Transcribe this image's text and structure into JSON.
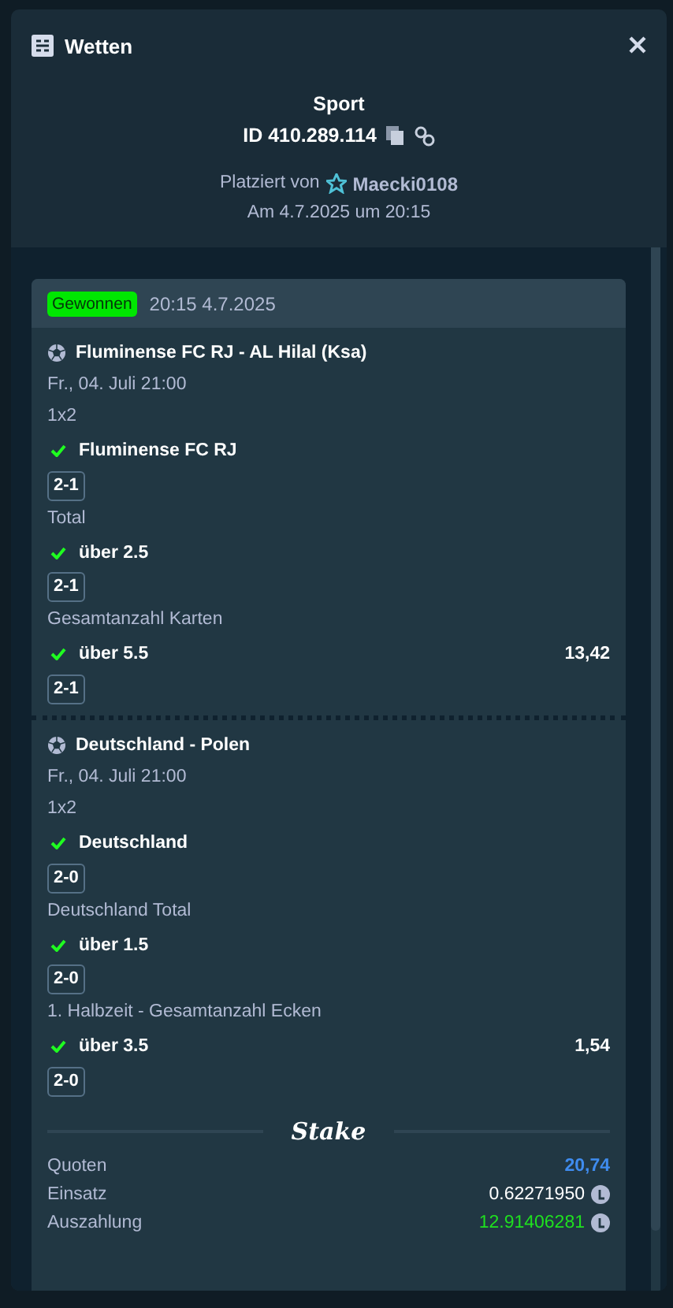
{
  "dialog": {
    "title": "Wetten"
  },
  "bet": {
    "category": "Sport",
    "id": "ID 410.289.114",
    "placed_by_label": "Platziert von",
    "user": "Maecki0108",
    "placed_at": "Am 4.7.2025 um 20:15"
  },
  "slip": {
    "status": {
      "label": "Gewonnen",
      "kind": "won"
    },
    "time": "20:15 4.7.2025",
    "events": [
      {
        "title": "Fluminense FC RJ - AL Hilal (Ksa)",
        "date": "Fr., 04. Juli 21:00",
        "markets": [
          {
            "market": "1x2",
            "selection": "Fluminense FC RJ",
            "won": true,
            "score": "2-1"
          },
          {
            "market": "Total",
            "selection": "über 2.5",
            "won": true,
            "score": "2-1"
          },
          {
            "market": "Gesamtanzahl Karten",
            "selection": "über 5.5",
            "won": true,
            "score": "2-1",
            "odds": "13,42"
          }
        ]
      },
      {
        "title": "Deutschland - Polen",
        "date": "Fr., 04. Juli 21:00",
        "markets": [
          {
            "market": "1x2",
            "selection": "Deutschland",
            "won": true,
            "score": "2-0"
          },
          {
            "market": "Deutschland Total",
            "selection": "über 1.5",
            "won": true,
            "score": "2-0"
          },
          {
            "market": "1. Halbzeit - Gesamtanzahl Ecken",
            "selection": "über 3.5",
            "won": true,
            "score": "2-0",
            "odds": "1,54"
          }
        ]
      }
    ],
    "brand": "Stake",
    "summary": [
      {
        "label": "Quoten",
        "value": "20,74",
        "kind": "odds"
      },
      {
        "label": "Einsatz",
        "value": "0.62271950",
        "kind": "stake"
      },
      {
        "label": "Auszahlung",
        "value": "12.91406281",
        "kind": "payout"
      }
    ]
  }
}
